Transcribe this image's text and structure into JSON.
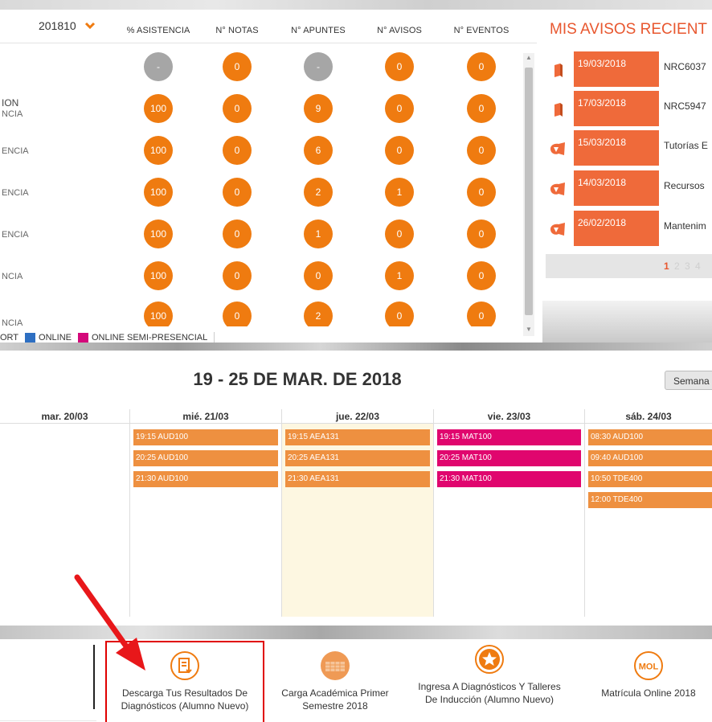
{
  "course_table": {
    "period": "201810",
    "columns": [
      "% ASISTENCIA",
      "N° NOTAS",
      "N° APUNTES",
      "N° AVISOS",
      "N° EVENTOS"
    ],
    "rows": [
      {
        "name": "",
        "sub": "",
        "asistencia": "-",
        "notas": "0",
        "apuntes": "-",
        "avisos": "0",
        "eventos": "0"
      },
      {
        "name": "ION",
        "sub": "NCIA",
        "asistencia": "100",
        "notas": "0",
        "apuntes": "9",
        "avisos": "0",
        "eventos": "0"
      },
      {
        "name": "",
        "sub": "ENCIA",
        "asistencia": "100",
        "notas": "0",
        "apuntes": "6",
        "avisos": "0",
        "eventos": "0"
      },
      {
        "name": "",
        "sub": "ENCIA",
        "asistencia": "100",
        "notas": "0",
        "apuntes": "2",
        "avisos": "1",
        "eventos": "0"
      },
      {
        "name": "",
        "sub": "ENCIA",
        "asistencia": "100",
        "notas": "0",
        "apuntes": "1",
        "avisos": "0",
        "eventos": "0"
      },
      {
        "name": "",
        "sub": "NCIA",
        "asistencia": "100",
        "notas": "0",
        "apuntes": "0",
        "avisos": "1",
        "eventos": "0"
      },
      {
        "name": "",
        "sub": "NCIA",
        "asistencia": "100",
        "notas": "0",
        "apuntes": "2",
        "avisos": "0",
        "eventos": "0"
      }
    ],
    "legend": [
      {
        "label": "ORT",
        "color": ""
      },
      {
        "label": "ONLINE",
        "color": "#2e6fc2"
      },
      {
        "label": "ONLINE SEMI-PRESENCIAL",
        "color": "#d4087a"
      }
    ]
  },
  "notices": {
    "title": "MIS AVISOS RECIENT",
    "items": [
      {
        "date": "19/03/2018",
        "text": "NRC6037",
        "icon": "book-icon"
      },
      {
        "date": "17/03/2018",
        "text": "NRC5947",
        "icon": "book-icon"
      },
      {
        "date": "15/03/2018",
        "text": "Tutorías E",
        "icon": "megaphone-icon"
      },
      {
        "date": "14/03/2018",
        "text": "Recursos",
        "icon": "megaphone-icon"
      },
      {
        "date": "26/02/2018",
        "text": "Mantenim",
        "icon": "megaphone-icon"
      }
    ],
    "pages": [
      "1",
      "2",
      "3",
      "4"
    ],
    "current_page": "1"
  },
  "calendar": {
    "title": "19 - 25 DE MAR. DE 2018",
    "view_button": "Semana",
    "days": [
      {
        "label": "mar. 20/03",
        "today": false,
        "events": []
      },
      {
        "label": "mié. 21/03",
        "today": false,
        "events": [
          {
            "text": "19:15 AUD100",
            "color": "orange"
          },
          {
            "text": "20:25 AUD100",
            "color": "orange"
          },
          {
            "text": "21:30 AUD100",
            "color": "orange"
          }
        ]
      },
      {
        "label": "jue. 22/03",
        "today": true,
        "events": [
          {
            "text": "19:15 AEA131",
            "color": "orange"
          },
          {
            "text": "20:25 AEA131",
            "color": "orange"
          },
          {
            "text": "21:30 AEA131",
            "color": "orange"
          }
        ]
      },
      {
        "label": "vie. 23/03",
        "today": false,
        "events": [
          {
            "text": "19:15 MAT100",
            "color": "pink"
          },
          {
            "text": "20:25 MAT100",
            "color": "pink"
          },
          {
            "text": "21:30 MAT100",
            "color": "pink"
          }
        ]
      },
      {
        "label": "sáb. 24/03",
        "today": false,
        "events": [
          {
            "text": "08:30 AUD100",
            "color": "orange"
          },
          {
            "text": "09:40 AUD100",
            "color": "orange"
          },
          {
            "text": "10:50 TDE400",
            "color": "orange"
          },
          {
            "text": "12:00 TDE400",
            "color": "orange"
          }
        ]
      }
    ]
  },
  "quick_links": [
    {
      "label": "Descarga Tus Resultados De Diagnósticos (Alumno Nuevo)",
      "icon": "document-download-icon"
    },
    {
      "label": "Carga Académica Primer Semestre 2018",
      "icon": "calendar-schedule-icon"
    },
    {
      "label": "Ingresa A Diagnósticos Y Talleres De Inducción (Alumno Nuevo)",
      "icon": "star-badge-icon"
    },
    {
      "label": "Matrícula Online 2018",
      "icon": "mol-icon",
      "icon_text": "MOL"
    }
  ],
  "colors": {
    "accent_orange": "#ef7b10",
    "notice_red": "#ef6a3a",
    "event_orange": "#ee9040",
    "event_pink": "#e0066e",
    "annotation_red": "#e00000"
  }
}
